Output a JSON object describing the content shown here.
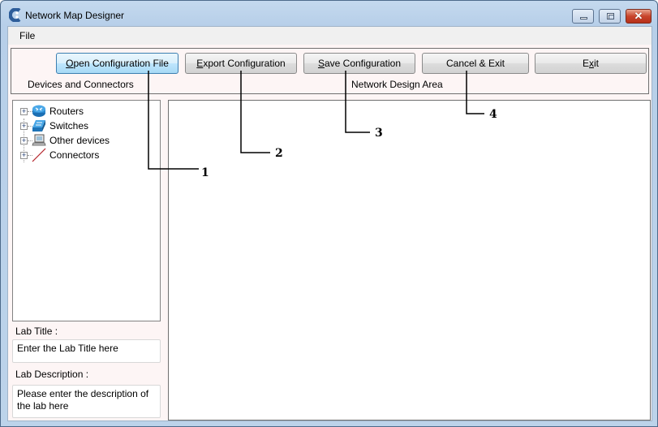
{
  "window": {
    "title": "Network Map Designer",
    "app_icon": "app-logo-icon",
    "controls": {
      "minimize_icon": "minimize-icon",
      "maximize_icon": "maximize-icon",
      "close_icon": "close-icon",
      "close_glyph": "✕"
    }
  },
  "menu": {
    "items": [
      {
        "label": "File"
      }
    ]
  },
  "toolbar": {
    "buttons": [
      {
        "label": "Open Configuration File",
        "mnemonic": "O",
        "rest": "pen Configuration File",
        "focused": true
      },
      {
        "label": "Export Configuration",
        "mnemonic": "E",
        "rest": "xport Configuration"
      },
      {
        "label": "Save Configuration",
        "mnemonic": "S",
        "rest": "ave Configuration"
      },
      {
        "label": "Cancel & Exit"
      },
      {
        "label": "Exit",
        "pre": "E",
        "mnemonic": "x",
        "rest": "it"
      }
    ],
    "devices_label": "Devices and Connectors",
    "design_label": "Network Design Area"
  },
  "tree": {
    "items": [
      {
        "label": "Routers",
        "icon": "router-icon",
        "expander": "+"
      },
      {
        "label": "Switches",
        "icon": "switch-icon",
        "expander": "+"
      },
      {
        "label": "Other devices",
        "icon": "computer-icon",
        "expander": "+"
      },
      {
        "label": "Connectors",
        "icon": "connector-line-icon",
        "expander": "+"
      }
    ]
  },
  "lab": {
    "title_label": "Lab Title :",
    "title_value": "Enter the Lab Title here",
    "description_label": "Lab Description :",
    "description_value": "Please enter the description of the lab here"
  },
  "callouts": [
    "1",
    "2",
    "3",
    "4"
  ]
}
